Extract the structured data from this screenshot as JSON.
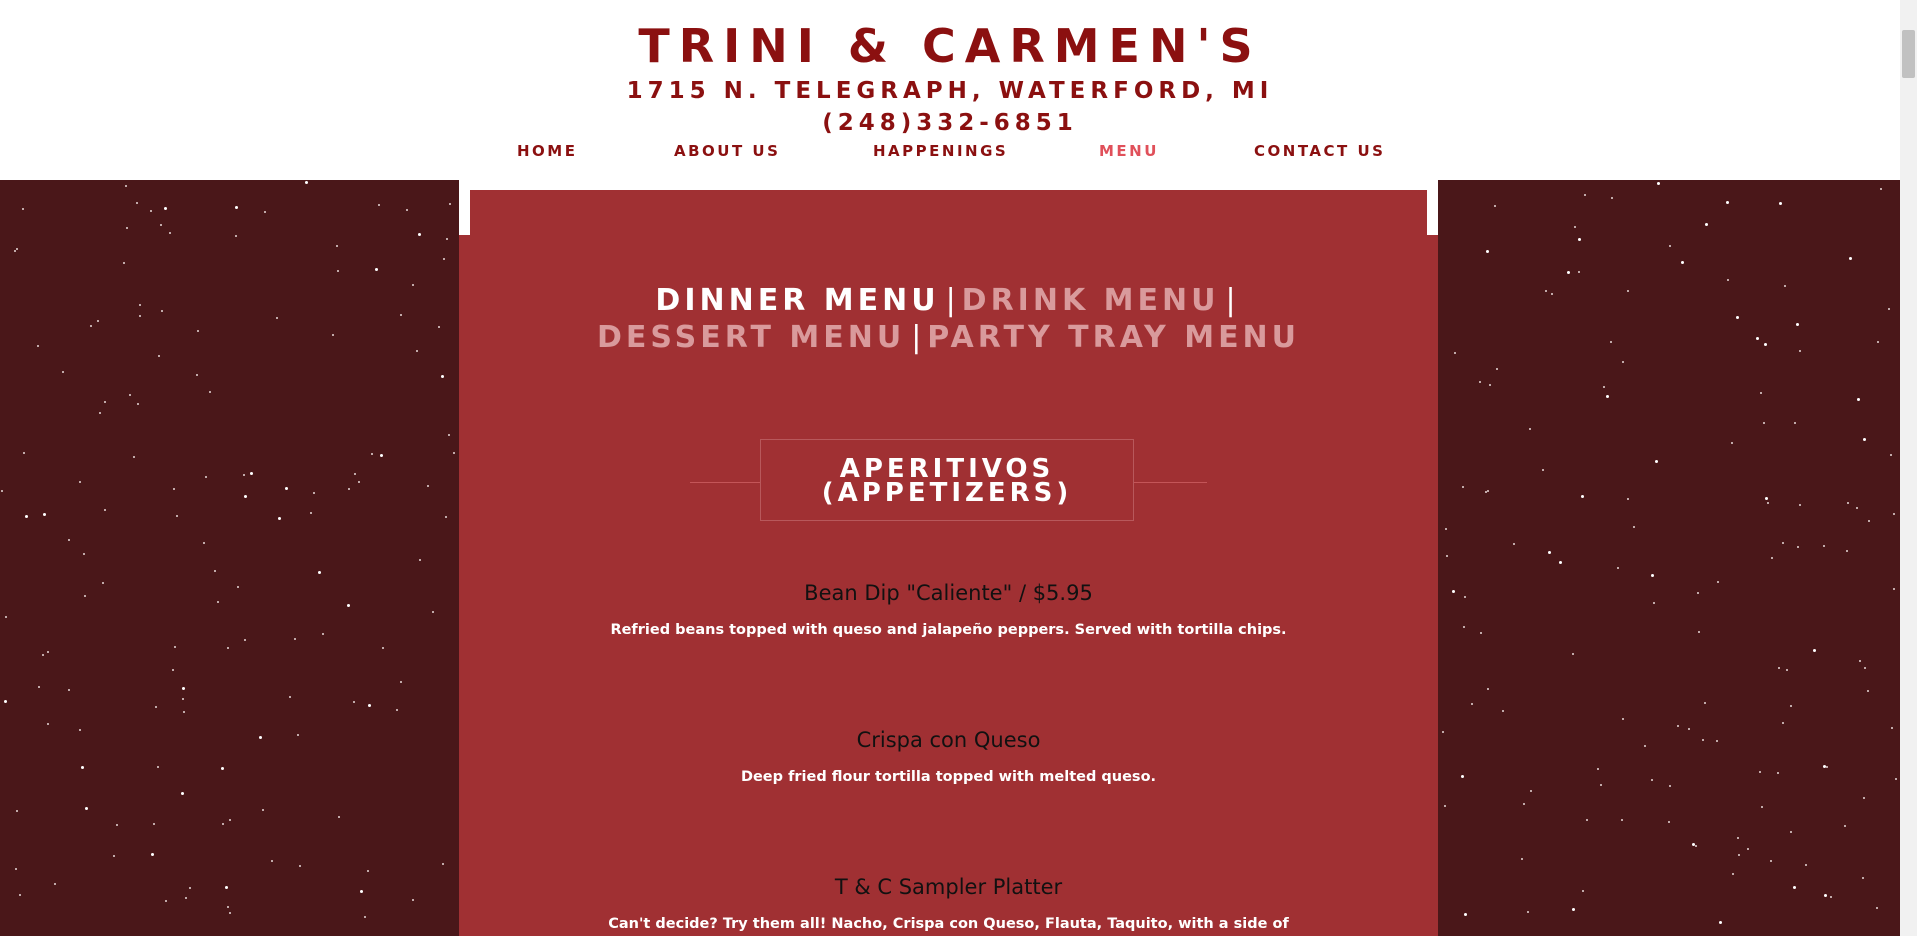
{
  "header": {
    "title": "TRINI & CARMEN'S",
    "address": "1715 N. TELEGRAPH, WATERFORD, MI",
    "phone": "(248)332-6851"
  },
  "nav": {
    "items": [
      {
        "label": "HOME"
      },
      {
        "label": "ABOUT US"
      },
      {
        "label": "HAPPENINGS"
      },
      {
        "label": "MENU",
        "active": true
      },
      {
        "label": "CONTACT US"
      }
    ]
  },
  "menu_tabs": {
    "dinner": "DINNER MENU",
    "drink": "DRINK MENU",
    "dessert": "DESSERT MENU",
    "party": "PARTY TRAY MENU",
    "separator": "|"
  },
  "section": {
    "title_line1": "APERITIVOS",
    "title_line2": "(APPETIZERS)"
  },
  "items": [
    {
      "name": "Bean Dip \"Caliente\"  /  $5.95",
      "desc": "Refried beans topped with queso and jalapeño peppers. Served with tortilla chips."
    },
    {
      "name": "Crispa con Queso",
      "desc": "Deep fried flour tortilla topped with melted queso."
    },
    {
      "name": "T & C Sampler Platter",
      "desc": "Can't decide? Try them all! Nacho, Crispa con Queso, Flauta, Taquito, with a side of"
    }
  ],
  "colors": {
    "brand_red": "#8b1010",
    "active_nav": "#e0505a",
    "panel_red": "#a03033",
    "background_maroon": "#4a1719"
  }
}
